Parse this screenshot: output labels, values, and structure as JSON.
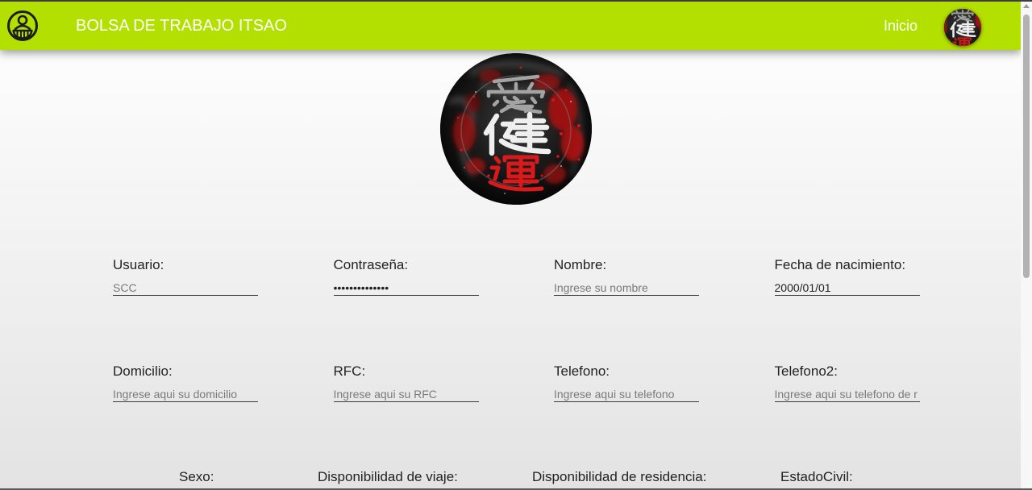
{
  "theme": {
    "accent": "#b3e000"
  },
  "navbar": {
    "logo_icon": "group-logo-icon",
    "title": "BOLSA DE TRABAJO ITSAO",
    "link_inicio": "Inicio",
    "avatar_icon": "profile-avatar-icon"
  },
  "profile_photo": {
    "icon": "profile-photo",
    "lettering": [
      "愛",
      "健",
      "運"
    ]
  },
  "form": {
    "fields": [
      {
        "label": "Usuario:",
        "placeholder": "SCC"
      },
      {
        "label": "Contraseña:",
        "value": "••••••••••••••"
      },
      {
        "label": "Nombre:",
        "placeholder": "Ingrese su nombre"
      },
      {
        "label": "Fecha de nacimiento:",
        "value": "2000/01/01"
      },
      {
        "label": "Domicilio:",
        "placeholder": "Ingrese aqui su domicilio"
      },
      {
        "label": "RFC:",
        "placeholder": "Ingrese aqui su RFC"
      },
      {
        "label": "Telefono:",
        "placeholder": "Ingrese aqui su telefono"
      },
      {
        "label": "Telefono2:",
        "placeholder": "Ingrese aqui su telefono de r"
      }
    ],
    "select_labels": [
      "Sexo:",
      "Disponibilidad de viaje:",
      "Disponibilidad de residencia:",
      "EstadoCivil:"
    ]
  }
}
